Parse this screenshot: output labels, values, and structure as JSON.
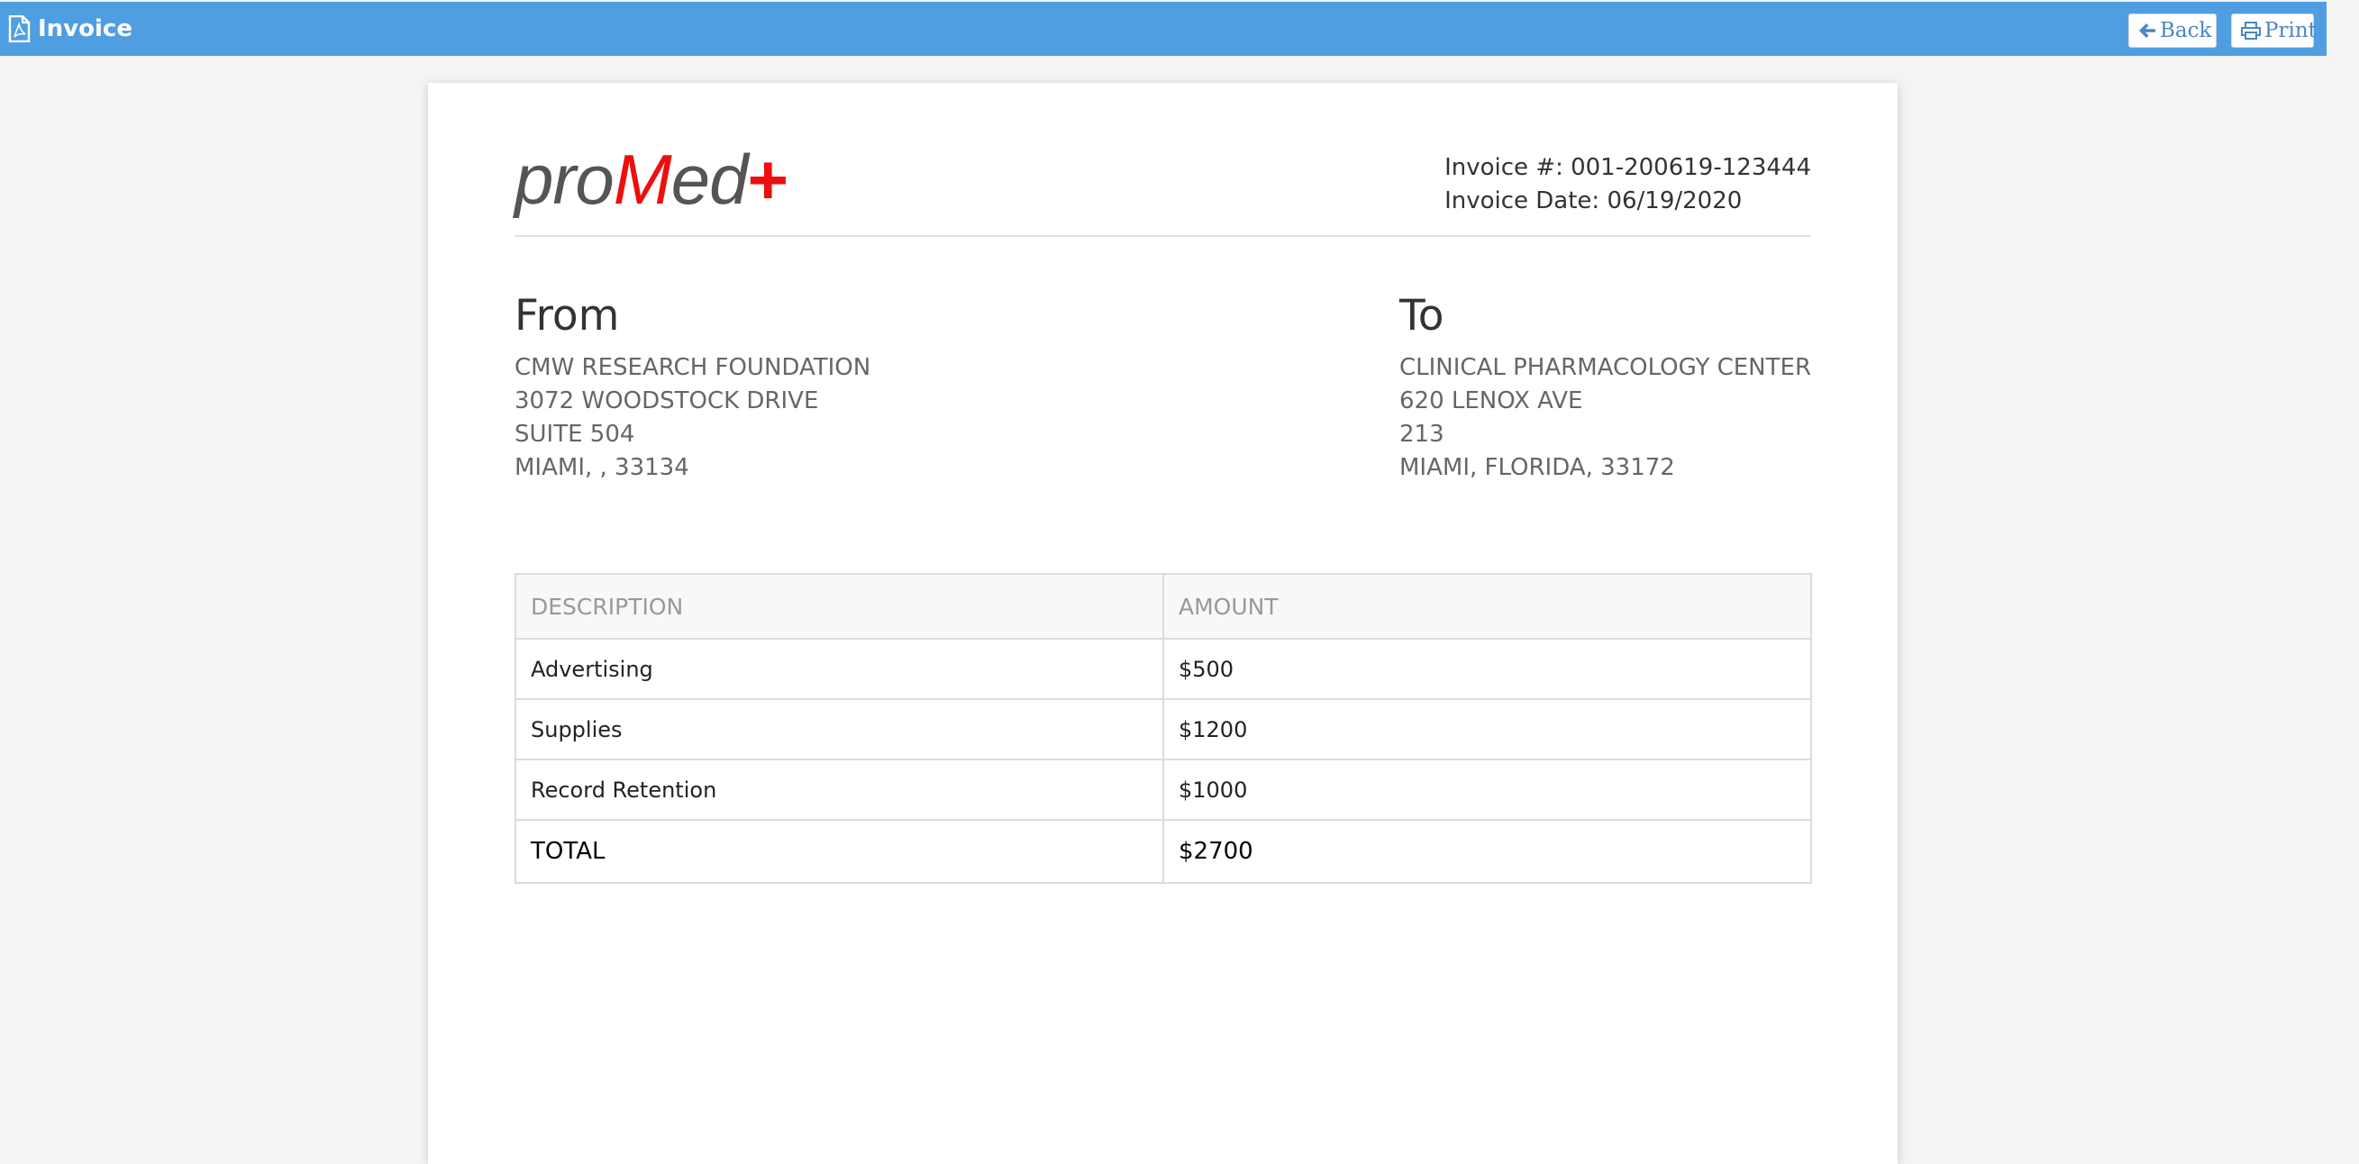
{
  "topbar": {
    "title": "Invoice",
    "title_icon": "pdf-file-icon",
    "back_label": "Back",
    "back_icon": "arrow-left-icon",
    "print_label": "Print",
    "print_icon": "printer-icon",
    "color": "#509ee2"
  },
  "invoice": {
    "logo": {
      "part1": "pro",
      "part2": "M",
      "part3": "ed",
      "part4": "+",
      "accent_color": "#ee0e0e"
    },
    "number_line": "Invoice #: 001-200619-123444",
    "date_line": "Invoice Date: 06/19/2020",
    "from": {
      "heading": "From",
      "lines": [
        "CMW RESEARCH FOUNDATION",
        "3072 WOODSTOCK DRIVE",
        "SUITE 504",
        "MIAMI, , 33134"
      ]
    },
    "to": {
      "heading": "To",
      "lines": [
        "CLINICAL PHARMACOLOGY CENTER",
        "620 LENOX AVE",
        "213",
        "MIAMI, FLORIDA, 33172"
      ]
    },
    "table": {
      "headers": [
        "DESCRIPTION",
        "AMOUNT"
      ],
      "rows": [
        {
          "description": "Advertising",
          "amount": "$500"
        },
        {
          "description": "Supplies",
          "amount": "$1200"
        },
        {
          "description": "Record Retention",
          "amount": "$1000"
        }
      ],
      "total": {
        "label": "TOTAL",
        "amount": "$2700"
      }
    }
  }
}
